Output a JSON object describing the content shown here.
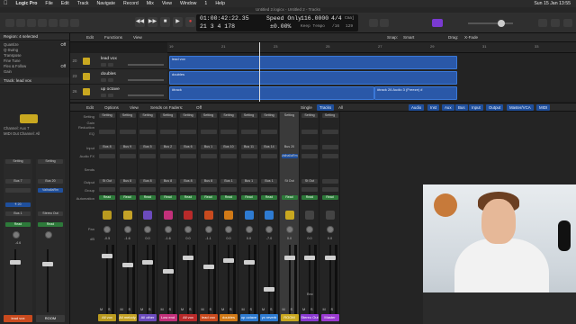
{
  "menubar": {
    "apple": "",
    "app": "Logic Pro",
    "items": [
      "File",
      "Edit",
      "Track",
      "Navigate",
      "Record",
      "Mix",
      "View",
      "Window",
      "1",
      "Help"
    ],
    "clock": "Sun 15 Jan 13:55"
  },
  "window_title": "Untitled 2.logicx - Untitled 2 - Tracks",
  "lcd": {
    "time": "01:00:42:22.35",
    "bars": "21  3  4  178",
    "mode": "Speed Only",
    "mode_value": "±0.00%",
    "tempo": "116.0000",
    "tempo_mode": "Keep Tempo",
    "sig": "4/4",
    "div": "/16",
    "key": "Cmaj",
    "beats": "129"
  },
  "toolbar": {
    "edit": "Edit",
    "functions": "Functions",
    "view": "View",
    "snap_label": "Snap:",
    "snap_value": "Smart",
    "drag_label": "Drag:",
    "drag_value": "X-Fade"
  },
  "inspector": {
    "region_header": "Region: 4 selected",
    "rows": [
      {
        "k": "Quantize",
        "v": "Off"
      },
      {
        "k": "Q-Swing",
        "v": ""
      },
      {
        "k": "Transpose",
        "v": ""
      },
      {
        "k": "Fine Tune",
        "v": ""
      },
      {
        "k": "Flex & Follow",
        "v": "Off"
      },
      {
        "k": "Gain",
        "v": ""
      }
    ],
    "track_header": "Track: lead vox",
    "channel_label": "Channel: Aux 7",
    "midi_label": "MIDI Out Channel: All",
    "strip_a_name": "lead vox",
    "strip_b_name": "ROOM",
    "bus_a": "Bus 7",
    "bus_b": "Bus 20",
    "out_a": "Bus 1",
    "out_b": "Stereo Out",
    "plugin": "ValhallaRm",
    "read": "Read",
    "pan_val": "-4.6"
  },
  "tracks": [
    {
      "num": "20",
      "name": "lead vox"
    },
    {
      "num": "23",
      "name": "doubles"
    },
    {
      "num": "26",
      "name": "up octave"
    }
  ],
  "ruler": [
    "19",
    "21",
    "23",
    "25",
    "27",
    "29",
    "31",
    "33"
  ],
  "regions": [
    {
      "label": "lead vox"
    },
    {
      "label": "doubles"
    },
    {
      "label": "#track"
    },
    {
      "label": "#track 26 Audio 3 (Freeze) #"
    }
  ],
  "mixer_header": {
    "edit": "Edit",
    "options": "Options",
    "view": "View",
    "sends": "Sends on Faders:",
    "sends_val": "Off",
    "single": "Single",
    "tracks": "Tracks",
    "all": "All",
    "filters": [
      "Audio",
      "Inst",
      "Aux",
      "Bus",
      "Input",
      "Output",
      "Master/VCA",
      "MIDI"
    ]
  },
  "row_labels": [
    "Setting",
    "Gain Reduction",
    "EQ",
    "Input",
    "Audio FX",
    "Sends",
    "Output",
    "Group",
    "Automation",
    "Pan",
    "dB"
  ],
  "strips": [
    {
      "input": "Bus 8",
      "output": "St Out",
      "read": "Read",
      "db": "-0.5",
      "name": "All vox",
      "color": "#b99a1f"
    },
    {
      "input": "Bus 9",
      "output": "Bus 8",
      "read": "Read",
      "db": "-1.6",
      "name": "All melody",
      "color": "#c4a227"
    },
    {
      "input": "Bus 5",
      "output": "Bus 8",
      "read": "Read",
      "db": "0.0",
      "name": "All other",
      "color": "#6b4bbd"
    },
    {
      "input": "Bus 2",
      "output": "Bus 8",
      "read": "Read",
      "db": "-1.6",
      "name": "Low end",
      "color": "#c2307a"
    },
    {
      "input": "Bus 6",
      "output": "Bus 8",
      "read": "Read",
      "db": "0.0",
      "name": "All vox",
      "color": "#b82a2a"
    },
    {
      "input": "Bus 1",
      "output": "Bus 8",
      "read": "Read",
      "db": "-1.1",
      "name": "lead vox",
      "color": "#c94a1e"
    },
    {
      "input": "Bus 10",
      "output": "Bus 1",
      "read": "Read",
      "db": "0.0",
      "name": "doubles",
      "color": "#d17a17"
    },
    {
      "input": "Bus 11",
      "output": "Bus 1",
      "read": "Read",
      "db": "0.0",
      "name": "up octave",
      "color": "#2e7bd1"
    },
    {
      "input": "Bus 14",
      "output": "Bus 1",
      "read": "Read",
      "db": "-7.0",
      "name": "yx reverb",
      "color": "#2e7bd1"
    },
    {
      "input": "Bus 20",
      "output": "St Out",
      "read": "Read",
      "db": "0.0",
      "name": "ROOM",
      "color": "#c9a820"
    },
    {
      "input": "",
      "output": "St Out",
      "read": "Read",
      "db": "0.0",
      "name": "Stereo Out",
      "color": "#8a3ad1"
    },
    {
      "input": "",
      "output": "",
      "read": "Read",
      "db": "0.0",
      "name": "Master",
      "color": "#9b3ad1"
    }
  ],
  "room_plugin": "ValhallaRm",
  "ruler_label": "Bnc"
}
